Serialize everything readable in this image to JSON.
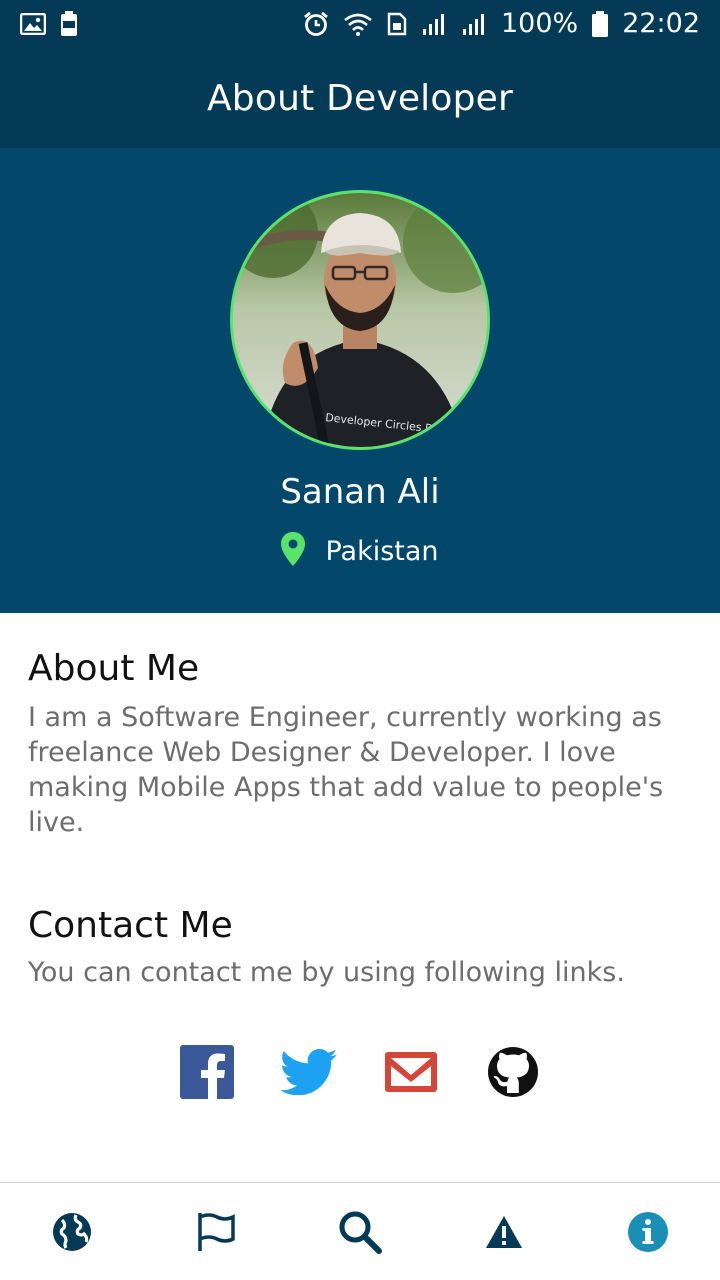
{
  "status_bar": {
    "battery_percent": "100%",
    "time": "22:02",
    "icons": [
      "image-icon",
      "battery-saver-icon",
      "alarm-icon",
      "wifi-icon",
      "sim-icon",
      "signal-icon",
      "signal-icon",
      "battery-icon"
    ]
  },
  "app_bar": {
    "title": "About Developer"
  },
  "profile": {
    "name": "Sanan Ali",
    "location": "Pakistan",
    "location_icon": "map-pin-icon",
    "avatar_shirt_text": "Developer Circles Pakistan"
  },
  "about": {
    "title": "About Me",
    "text": "I am a Software Engineer, currently working as freelance Web Designer & Developer. I love making Mobile Apps that add value to people's live."
  },
  "contact": {
    "title": "Contact Me",
    "text": "You can contact me by using following links.",
    "links": [
      "facebook-icon",
      "twitter-icon",
      "gmail-icon",
      "github-icon"
    ]
  },
  "bottom_nav": {
    "items": [
      "globe-icon",
      "flag-icon",
      "search-icon",
      "warning-icon",
      "info-icon"
    ],
    "active": "info-icon"
  },
  "colors": {
    "primary_dark": "#053a57",
    "primary": "#03476a",
    "accent_green": "#58e36a",
    "facebook": "#3b5998",
    "twitter": "#1da1f2",
    "gmail": "#d44638",
    "info_active": "#1a8fb5"
  }
}
